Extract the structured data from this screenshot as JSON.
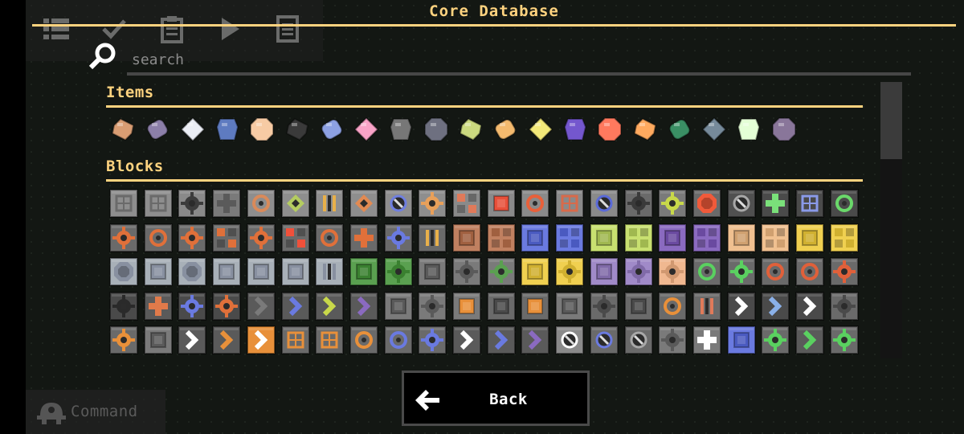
{
  "title": "Core Database",
  "search": {
    "placeholder": "search",
    "value": ""
  },
  "sections": {
    "items": {
      "title": "Items"
    },
    "blocks": {
      "title": "Blocks"
    }
  },
  "items": [
    {
      "icon": "copper-icon",
      "color": "#d99d73"
    },
    {
      "icon": "lead-icon",
      "color": "#8c7fa9"
    },
    {
      "icon": "metaglass-icon",
      "color": "#ebeef5"
    },
    {
      "icon": "graphite-icon",
      "color": "#5e7bc0"
    },
    {
      "icon": "sand-icon",
      "color": "#f7cba4"
    },
    {
      "icon": "coal-icon",
      "color": "#3a3a3a"
    },
    {
      "icon": "titanium-icon",
      "color": "#8da1e3"
    },
    {
      "icon": "thorium-icon",
      "color": "#f9a3c7"
    },
    {
      "icon": "scrap-icon",
      "color": "#777777"
    },
    {
      "icon": "silicon-icon",
      "color": "#6e7080"
    },
    {
      "icon": "plastanium-icon",
      "color": "#cbd97f"
    },
    {
      "icon": "phase-fabric-icon",
      "color": "#f4ba6e"
    },
    {
      "icon": "surge-alloy-icon",
      "color": "#f3e979"
    },
    {
      "icon": "spore-pod-icon",
      "color": "#7457ce"
    },
    {
      "icon": "blast-compound-icon",
      "color": "#ff795e"
    },
    {
      "icon": "pyratite-icon",
      "color": "#ffaa5f"
    },
    {
      "icon": "beryllium-icon",
      "color": "#3a8f64"
    },
    {
      "icon": "tungsten-icon",
      "color": "#768a9a"
    },
    {
      "icon": "oxide-icon",
      "color": "#e4ffd6"
    },
    {
      "icon": "carbide-icon",
      "color": "#89769a"
    }
  ],
  "blocks": {
    "rows": [
      [
        {
          "base": "#8e8e8e",
          "accent": "#6a6a6a",
          "motif": "grid"
        },
        {
          "base": "#8e8e8e",
          "accent": "#6a6a6a",
          "motif": "grid"
        },
        {
          "base": "#8a8a8a",
          "accent": "#3c3c3c",
          "motif": "gear"
        },
        {
          "base": "#7a7a7a",
          "accent": "#5a5a5a",
          "motif": "cross"
        },
        {
          "base": "#8e8e8e",
          "accent": "#d98a5a",
          "motif": "ring"
        },
        {
          "base": "#8e8e8e",
          "accent": "#b4cc60",
          "motif": "diamond"
        },
        {
          "base": "#8e8e8e",
          "accent": "#e8b04a",
          "motif": "stripes"
        },
        {
          "base": "#8e8e8e",
          "accent": "#e28a52",
          "motif": "diamond"
        },
        {
          "base": "#8e8e8e",
          "accent": "#6f7fe0",
          "motif": "slash"
        },
        {
          "base": "#8e8e8e",
          "accent": "#e8a05a",
          "motif": "gear"
        },
        {
          "base": "#8a8a8a",
          "accent": "#e07a5a",
          "motif": "check"
        },
        {
          "base": "#8a8a8a",
          "accent": "#e8503a",
          "motif": "square"
        },
        {
          "base": "#8a8a8a",
          "accent": "#e8603a",
          "motif": "ring"
        },
        {
          "base": "#8a8a8a",
          "accent": "#d86a4a",
          "motif": "grid"
        },
        {
          "base": "#8a8a8a",
          "accent": "#5a6ad8",
          "motif": "slash"
        },
        {
          "base": "#6a6a6a",
          "accent": "#3a3a3a",
          "motif": "gear"
        },
        {
          "base": "#7a7a7a",
          "accent": "#c8d84a",
          "motif": "gear"
        },
        {
          "base": "#6a6a6a",
          "accent": "#f05a3a",
          "motif": "octagon"
        },
        {
          "base": "#505050",
          "accent": "#a8a8a8",
          "motif": "slash"
        },
        {
          "base": "#4a4a4a",
          "accent": "#7ae07a",
          "motif": "cross"
        },
        {
          "base": "#4a4a4a",
          "accent": "#8a9ae8",
          "motif": "grid"
        },
        {
          "base": "#4a4a4a",
          "accent": "#6ad86a",
          "motif": "ring"
        }
      ],
      [
        {
          "base": "#6a6a6a",
          "accent": "#e0703a",
          "motif": "gear"
        },
        {
          "base": "#6a6a6a",
          "accent": "#e0703a",
          "motif": "ring"
        },
        {
          "base": "#6a6a6a",
          "accent": "#e0703a",
          "motif": "gear"
        },
        {
          "base": "#6a6a6a",
          "accent": "#e0703a",
          "motif": "check"
        },
        {
          "base": "#6a6a6a",
          "accent": "#e0703a",
          "motif": "gear"
        },
        {
          "base": "#6a6a6a",
          "accent": "#f0503a",
          "motif": "check"
        },
        {
          "base": "#6a6a6a",
          "accent": "#e0703a",
          "motif": "ring"
        },
        {
          "base": "#6a6a6a",
          "accent": "#e0703a",
          "motif": "cross"
        },
        {
          "base": "#6a6a6a",
          "accent": "#6a7ae0",
          "motif": "gear"
        },
        {
          "base": "#6a6a6a",
          "accent": "#e8b04a",
          "motif": "stripes"
        },
        {
          "base": "#c08060",
          "accent": "#a06040",
          "motif": "square"
        },
        {
          "base": "#c08060",
          "accent": "#a06040",
          "motif": "check"
        },
        {
          "base": "#6a7ae0",
          "accent": "#4a5ac0",
          "motif": "square"
        },
        {
          "base": "#6a7ae0",
          "accent": "#4a5ac0",
          "motif": "check"
        },
        {
          "base": "#c8e070",
          "accent": "#a0b850",
          "motif": "square"
        },
        {
          "base": "#c8e070",
          "accent": "#a0b850",
          "motif": "check"
        },
        {
          "base": "#8a6ac0",
          "accent": "#6a4aa0",
          "motif": "square"
        },
        {
          "base": "#8a6ac0",
          "accent": "#6a4aa0",
          "motif": "check"
        },
        {
          "base": "#f0c090",
          "accent": "#d0a070",
          "motif": "square"
        },
        {
          "base": "#f0c090",
          "accent": "#d0a070",
          "motif": "check"
        },
        {
          "base": "#f0d050",
          "accent": "#d0b030",
          "motif": "square"
        },
        {
          "base": "#f0d050",
          "accent": "#d0b030",
          "motif": "check"
        }
      ],
      [
        {
          "base": "#a8b0b8",
          "accent": "#8890a0",
          "motif": "octagon"
        },
        {
          "base": "#a8b0b8",
          "accent": "#8890a0",
          "motif": "square"
        },
        {
          "base": "#a8b0b8",
          "accent": "#8890a0",
          "motif": "octagon"
        },
        {
          "base": "#a8b0b8",
          "accent": "#8890a0",
          "motif": "square"
        },
        {
          "base": "#a8b0b8",
          "accent": "#8890a0",
          "motif": "square"
        },
        {
          "base": "#a8b0b8",
          "accent": "#8890a0",
          "motif": "square"
        },
        {
          "base": "#a8b0b8",
          "accent": "#8890a0",
          "motif": "stripes"
        },
        {
          "base": "#5aa050",
          "accent": "#3a8030",
          "motif": "square"
        },
        {
          "base": "#5aa050",
          "accent": "#3a8030",
          "motif": "gear"
        },
        {
          "base": "#7a7a7a",
          "accent": "#5a5a5a",
          "motif": "square"
        },
        {
          "base": "#7a7a7a",
          "accent": "#5a5a5a",
          "motif": "gear"
        },
        {
          "base": "#7a7a7a",
          "accent": "#5aa050",
          "motif": "gear"
        },
        {
          "base": "#f0d050",
          "accent": "#d0b030",
          "motif": "square"
        },
        {
          "base": "#f0d050",
          "accent": "#d0b030",
          "motif": "gear"
        },
        {
          "base": "#a08ac8",
          "accent": "#806aa8",
          "motif": "square"
        },
        {
          "base": "#a08ac8",
          "accent": "#806aa8",
          "motif": "gear"
        },
        {
          "base": "#f0b890",
          "accent": "#d09870",
          "motif": "gear"
        },
        {
          "base": "#6a6a6a",
          "accent": "#5ad060",
          "motif": "ring"
        },
        {
          "base": "#6a6a6a",
          "accent": "#5ad060",
          "motif": "gear"
        },
        {
          "base": "#6a6a6a",
          "accent": "#e0603a",
          "motif": "ring"
        },
        {
          "base": "#6a6a6a",
          "accent": "#e0603a",
          "motif": "ring"
        },
        {
          "base": "#6a6a6a",
          "accent": "#e0603a",
          "motif": "gear"
        }
      ],
      [
        {
          "base": "#4a4a4a",
          "accent": "#2a2a2a",
          "motif": "gear"
        },
        {
          "base": "#5a5a5a",
          "accent": "#e07a4a",
          "motif": "cross"
        },
        {
          "base": "#4a4a4a",
          "accent": "#6a7ae0",
          "motif": "gear"
        },
        {
          "base": "#4a4a4a",
          "accent": "#e0703a",
          "motif": "gear"
        },
        {
          "base": "#5a5a5a",
          "accent": "#7a7a7a",
          "motif": "chevron"
        },
        {
          "base": "#5a5a5a",
          "accent": "#6a7ae0",
          "motif": "chevron"
        },
        {
          "base": "#5a5a5a",
          "accent": "#c8d84a",
          "motif": "chevron"
        },
        {
          "base": "#5a5a5a",
          "accent": "#8a6ac0",
          "motif": "chevron"
        },
        {
          "base": "#7a7a7a",
          "accent": "#5a5a5a",
          "motif": "square"
        },
        {
          "base": "#7a7a7a",
          "accent": "#5a5a5a",
          "motif": "gear"
        },
        {
          "base": "#7a7a7a",
          "accent": "#e8903a",
          "motif": "square"
        },
        {
          "base": "#6a6a6a",
          "accent": "#4a4a4a",
          "motif": "square"
        },
        {
          "base": "#6a6a6a",
          "accent": "#e8903a",
          "motif": "square"
        },
        {
          "base": "#7a7a7a",
          "accent": "#5a5a5a",
          "motif": "square"
        },
        {
          "base": "#6a6a6a",
          "accent": "#4a4a4a",
          "motif": "gear"
        },
        {
          "base": "#6a6a6a",
          "accent": "#4a4a4a",
          "motif": "square"
        },
        {
          "base": "#6a6a6a",
          "accent": "#e8903a",
          "motif": "ring"
        },
        {
          "base": "#6a6a6a",
          "accent": "#e07a5a",
          "motif": "stripes"
        },
        {
          "base": "#4a4a4a",
          "accent": "#ffffff",
          "motif": "chevron"
        },
        {
          "base": "#4a4a4a",
          "accent": "#8ab0e8",
          "motif": "chevron"
        },
        {
          "base": "#4a4a4a",
          "accent": "#ffffff",
          "motif": "chevron"
        },
        {
          "base": "#6a6a6a",
          "accent": "#4a4a4a",
          "motif": "gear"
        }
      ],
      [
        {
          "base": "#6a6a6a",
          "accent": "#e8903a",
          "motif": "gear"
        },
        {
          "base": "#7a7a7a",
          "accent": "#5a5a5a",
          "motif": "square"
        },
        {
          "base": "#5a5a5a",
          "accent": "#ffffff",
          "motif": "chevron"
        },
        {
          "base": "#5a5a5a",
          "accent": "#e8903a",
          "motif": "chevron"
        },
        {
          "base": "#e8903a",
          "accent": "#ffffff",
          "motif": "chevron"
        },
        {
          "base": "#6a6a6a",
          "accent": "#e8903a",
          "motif": "grid"
        },
        {
          "base": "#6a6a6a",
          "accent": "#e8903a",
          "motif": "grid"
        },
        {
          "base": "#6a6a6a",
          "accent": "#e8903a",
          "motif": "ring"
        },
        {
          "base": "#6a6a6a",
          "accent": "#6a7ae0",
          "motif": "ring"
        },
        {
          "base": "#6a6a6a",
          "accent": "#6a7ae0",
          "motif": "gear"
        },
        {
          "base": "#5a5a5a",
          "accent": "#ffffff",
          "motif": "chevron"
        },
        {
          "base": "#5a5a5a",
          "accent": "#6a7ae0",
          "motif": "chevron"
        },
        {
          "base": "#5a5a5a",
          "accent": "#8a6ac0",
          "motif": "chevron"
        },
        {
          "base": "#8a8a8a",
          "accent": "#ffffff",
          "motif": "slash"
        },
        {
          "base": "#6a6a6a",
          "accent": "#6a7ae0",
          "motif": "slash"
        },
        {
          "base": "#6a6a6a",
          "accent": "#a8a8a8",
          "motif": "slash"
        },
        {
          "base": "#7a7a7a",
          "accent": "#5a5a5a",
          "motif": "gear"
        },
        {
          "base": "#7a7a7a",
          "accent": "#ffffff",
          "motif": "cross"
        },
        {
          "base": "#6a7ae0",
          "accent": "#4a5ac0",
          "motif": "square"
        },
        {
          "base": "#6a6a6a",
          "accent": "#5ad060",
          "motif": "gear"
        },
        {
          "base": "#5a5a5a",
          "accent": "#5ad060",
          "motif": "chevron"
        },
        {
          "base": "#6a6a6a",
          "accent": "#5ad060",
          "motif": "gear"
        }
      ]
    ]
  },
  "back_button": {
    "label": "Back"
  },
  "hud": {
    "command_label": "Command"
  },
  "colors": {
    "accent": "#ffd37f",
    "background": "#131713",
    "text": "#ffffff",
    "muted": "#8b8b8b"
  }
}
